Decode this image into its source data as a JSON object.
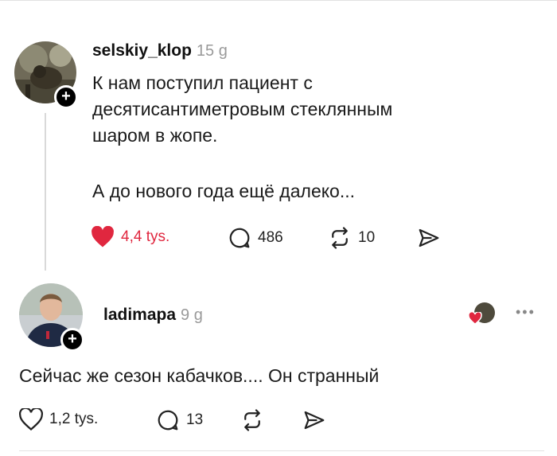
{
  "post": {
    "username": "selskiy_klop",
    "time": "15 g",
    "text": "К нам поступил пациент с\nдесятисантиметровым стеклянным\nшаром в жопе.",
    "text2": "А до нового года ещё далеко...",
    "likes": "4,4 tys.",
    "comments": "486",
    "reposts": "10",
    "liked": true
  },
  "reply": {
    "username": "ladimapa",
    "time": "9 g",
    "text": "Сейчас же сезон кабачков.... Он странный",
    "likes": "1,2 tys.",
    "comments": "13"
  },
  "colors": {
    "like": "#e0273f",
    "muted": "#9a9a9a",
    "line": "#d9d9d9"
  },
  "icons": [
    "plus-icon",
    "heart-icon",
    "comment-icon",
    "repost-icon",
    "share-icon",
    "more-icon"
  ]
}
